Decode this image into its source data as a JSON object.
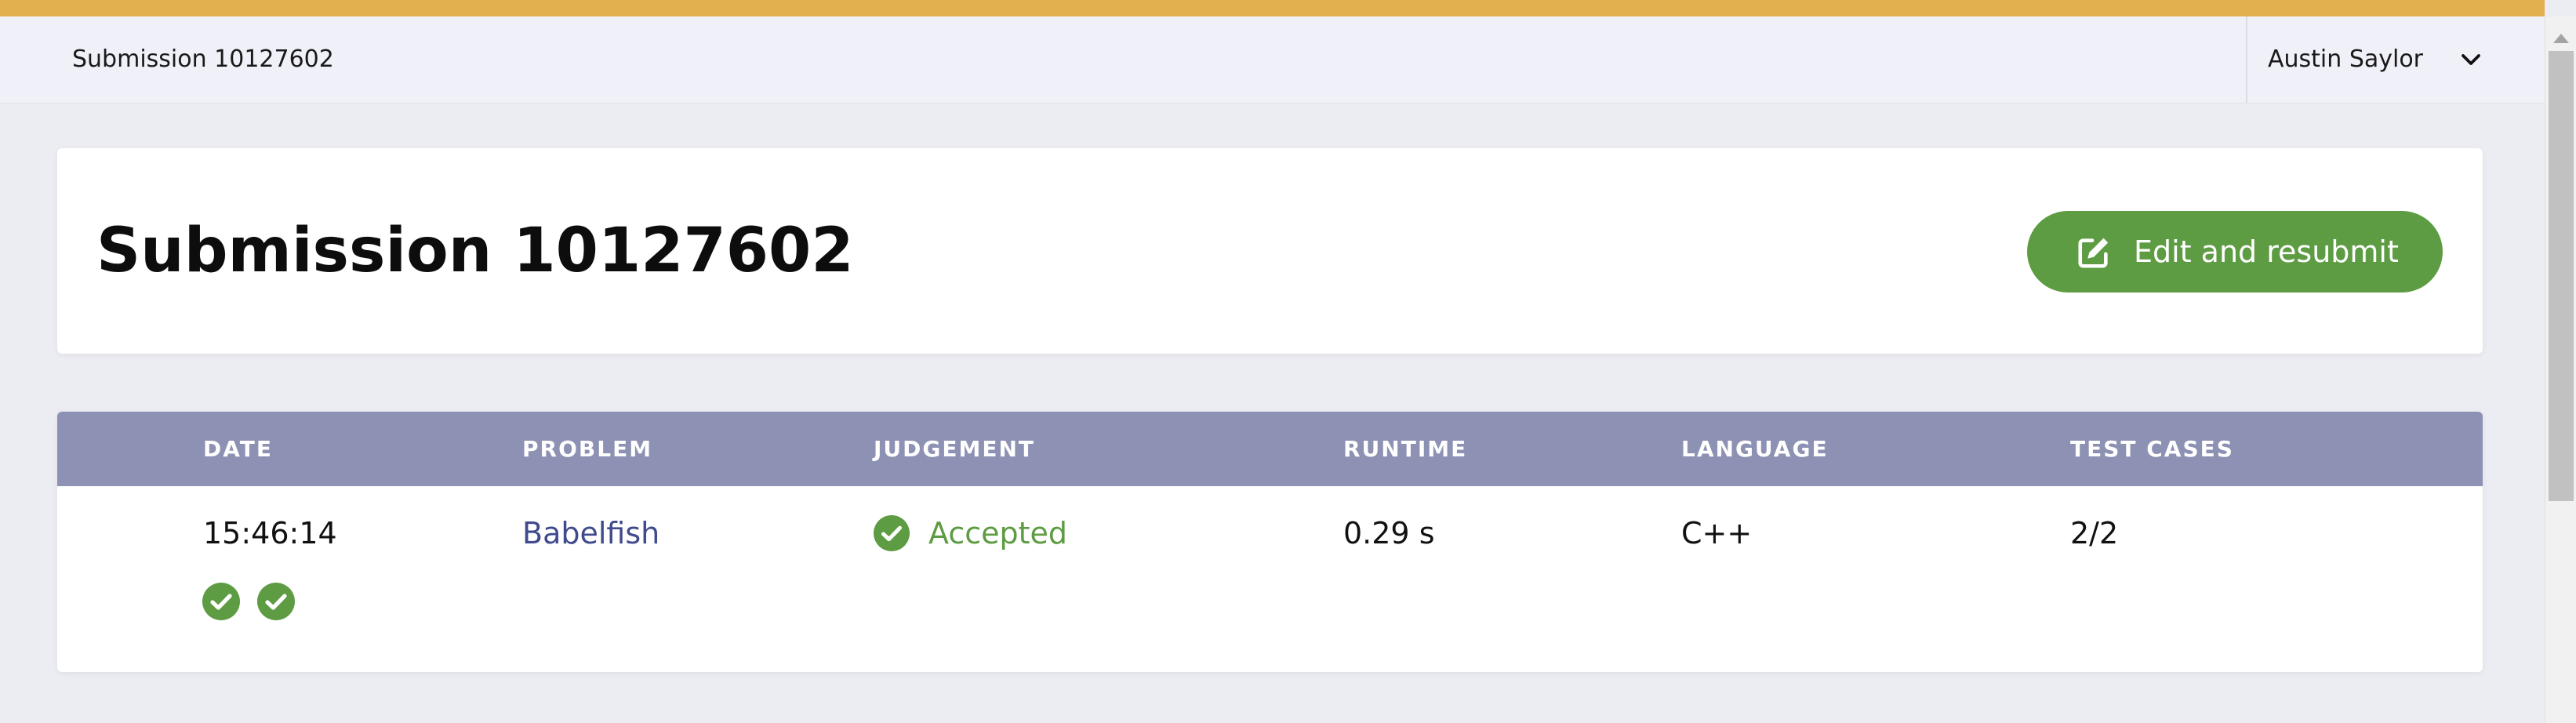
{
  "topbar": {
    "title": "Submission 10127602",
    "user_name": "Austin Saylor"
  },
  "header": {
    "title": "Submission 10127602",
    "resubmit_label": "Edit and resubmit"
  },
  "table": {
    "columns": [
      "DATE",
      "PROBLEM",
      "JUDGEMENT",
      "RUNTIME",
      "LANGUAGE",
      "TEST CASES"
    ],
    "row": {
      "date": "15:46:14",
      "problem": "Babelfish",
      "judgement": "Accepted",
      "runtime": "0.29 s",
      "language": "C++",
      "test_cases": "2/2",
      "test_case_results": [
        "accepted",
        "accepted"
      ]
    }
  },
  "colors": {
    "accent_strip": "#e2b04f",
    "accepted_green": "#5d9c42",
    "table_header": "#8d91b3",
    "link": "#3f4b8c"
  },
  "icons": {
    "user_menu": "chevron-down-icon",
    "resubmit": "edit-icon",
    "judgement": "check-circle-icon"
  }
}
